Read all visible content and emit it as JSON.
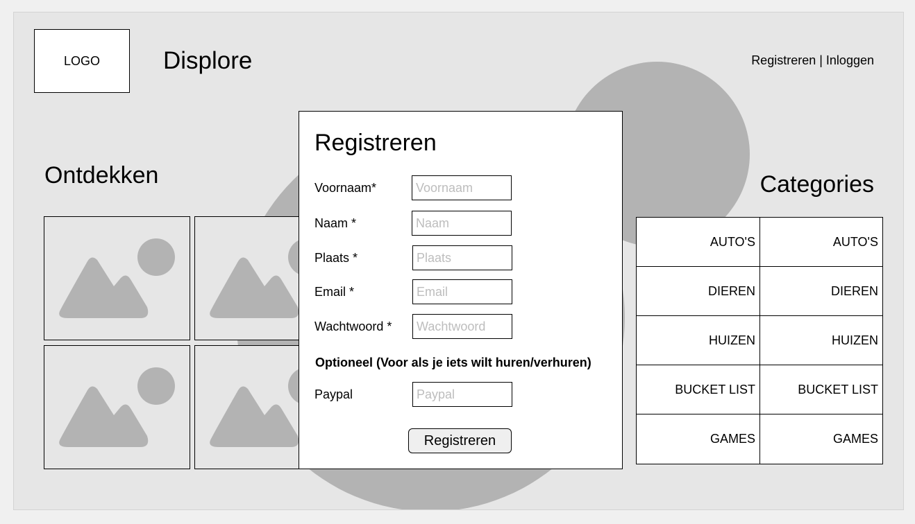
{
  "header": {
    "logo_text": "LOGO",
    "brand": "Displore",
    "auth": {
      "register": "Registreren",
      "separator": " | ",
      "login": "Inloggen"
    }
  },
  "discover": {
    "title": "Ontdekken",
    "image_icon": "image-placeholder-icon"
  },
  "categories": {
    "title": "Categories",
    "rows": [
      [
        "AUTO'S",
        "AUTO'S"
      ],
      [
        "DIEREN",
        "DIEREN"
      ],
      [
        "HUIZEN",
        "HUIZEN"
      ],
      [
        "BUCKET LIST",
        "BUCKET LIST"
      ],
      [
        "GAMES",
        "GAMES"
      ]
    ]
  },
  "register_form": {
    "title": "Registreren",
    "fields": {
      "voornaam": {
        "label": "Voornaam*",
        "placeholder": "Voornaam",
        "value": ""
      },
      "naam": {
        "label": "Naam *",
        "placeholder": "Naam",
        "value": ""
      },
      "plaats": {
        "label": "Plaats *",
        "placeholder": "Plaats",
        "value": ""
      },
      "email": {
        "label": "Email *",
        "placeholder": "Email",
        "value": ""
      },
      "wachtwoord": {
        "label": "Wachtwoord *",
        "placeholder": "Wachtwoord",
        "value": ""
      },
      "paypal": {
        "label": "Paypal",
        "placeholder": "Paypal",
        "value": ""
      }
    },
    "optional_heading": "Optioneel (Voor als je iets wilt huren/verhuren)",
    "submit_label": "Registreren"
  },
  "colors": {
    "canvas": "#e6e6e6",
    "decoration": "#b3b3b3",
    "placeholder_text": "#bdbdbd"
  }
}
